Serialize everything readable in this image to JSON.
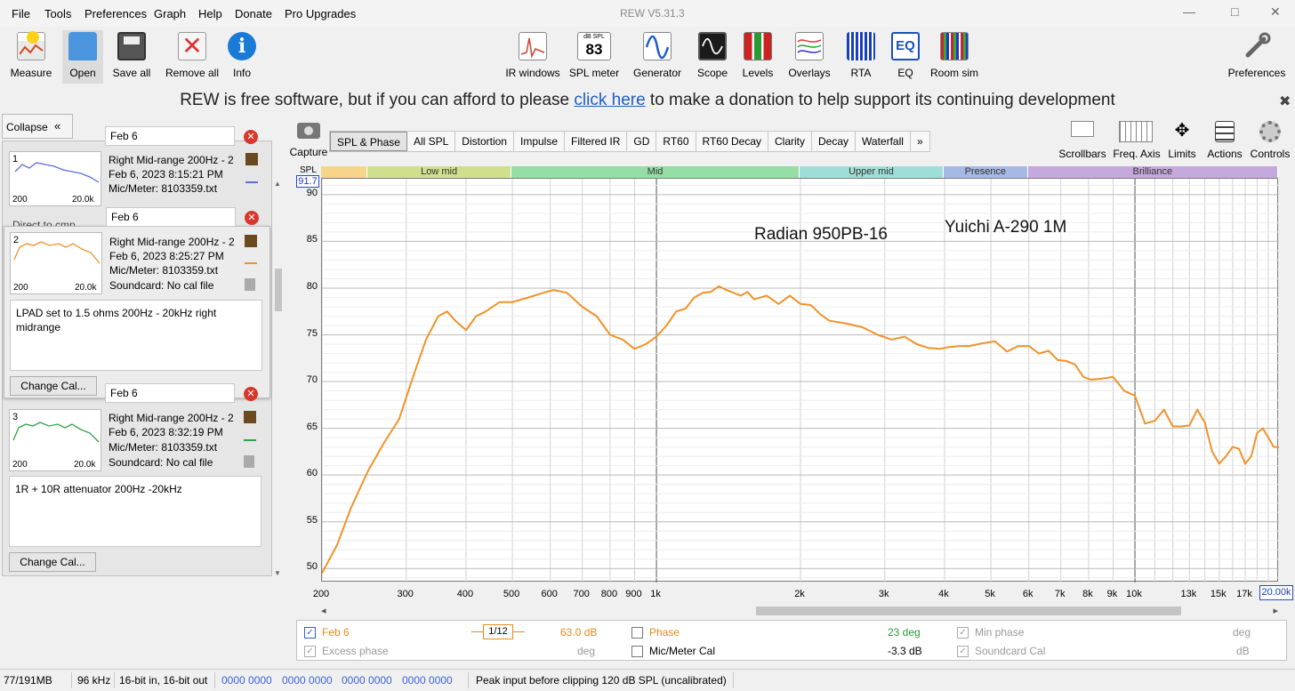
{
  "window": {
    "title": "REW V5.31.3",
    "minimize": "—",
    "maximize": "□",
    "close": "✕"
  },
  "menu": [
    "File",
    "Tools",
    "Preferences",
    "Graph",
    "Help",
    "Donate",
    "Pro Upgrades"
  ],
  "toolbar": {
    "left": [
      {
        "label": "Measure",
        "icon": "measure-icon"
      },
      {
        "label": "Open",
        "icon": "open-folder-icon"
      },
      {
        "label": "Save all",
        "icon": "save-all-icon"
      },
      {
        "label": "Remove all",
        "icon": "remove-all-icon"
      },
      {
        "label": "Info",
        "icon": "info-icon"
      }
    ],
    "center": [
      {
        "label": "IR windows",
        "icon": "ir-windows-icon"
      },
      {
        "label": "SPL meter",
        "icon": "spl-meter-icon",
        "top": "dB SPL",
        "value": "83"
      },
      {
        "label": "Generator",
        "icon": "generator-icon"
      },
      {
        "label": "Scope",
        "icon": "scope-icon"
      },
      {
        "label": "Levels",
        "icon": "levels-icon"
      },
      {
        "label": "Overlays",
        "icon": "overlays-icon"
      },
      {
        "label": "RTA",
        "icon": "rta-icon"
      },
      {
        "label": "EQ",
        "icon": "eq-icon"
      },
      {
        "label": "Room sim",
        "icon": "room-sim-icon"
      }
    ],
    "right": {
      "label": "Preferences",
      "icon": "wrench-icon"
    }
  },
  "donation": {
    "before": "REW is free software, but if you can afford to please ",
    "link": "click here",
    "after": " to make a donation to help support its continuing development",
    "close": "✖"
  },
  "sidebar": {
    "collapse_label": "Collapse",
    "collapse_icon": "«",
    "measurements": [
      {
        "num": "1",
        "name": "Feb 6",
        "title": "Right Mid-range 200Hz - 2",
        "date": "Feb 6, 2023 8:15:21 PM",
        "mic": "Mic/Meter: 8103359.txt",
        "sound": "",
        "x_start": "200",
        "x_end": "20.0k",
        "color": "#5a6ee0",
        "notes": "",
        "partial": "Direct to cmp",
        "show_change_cal": false
      },
      {
        "num": "2",
        "name": "Feb 6",
        "title": "Right Mid-range 200Hz - 2",
        "date": "Feb 6, 2023 8:25:27 PM",
        "mic": "Mic/Meter: 8103359.txt",
        "sound": "Soundcard: No cal file",
        "x_start": "200",
        "x_end": "20.0k",
        "color": "#f0922a",
        "notes": "LPAD set to 1.5 ohms 200Hz - 20kHz right midrange",
        "change_cal": "Change Cal..."
      },
      {
        "num": "3",
        "name": "Feb 6",
        "title": "Right Mid-range 200Hz - 2",
        "date": "Feb 6, 2023 8:32:19 PM",
        "mic": "Mic/Meter: 8103359.txt",
        "sound": "Soundcard: No cal file",
        "x_start": "200",
        "x_end": "20.0k",
        "color": "#2fa34a",
        "notes": "1R + 10R attenuator 200Hz -20kHz",
        "change_cal": "Change Cal..."
      }
    ]
  },
  "graph": {
    "capture_label": "Capture",
    "tabs": [
      "SPL & Phase",
      "All SPL",
      "Distortion",
      "Impulse",
      "Filtered IR",
      "GD",
      "RT60",
      "RT60 Decay",
      "Clarity",
      "Decay",
      "Waterfall",
      "»"
    ],
    "active_tab": "SPL & Phase",
    "right_controls": [
      {
        "label": "Scrollbars",
        "icon": "scrollbars-icon"
      },
      {
        "label": "Freq. Axis",
        "icon": "freq-axis-icon"
      },
      {
        "label": "Limits",
        "icon": "limits-icon"
      },
      {
        "label": "Actions",
        "icon": "actions-icon"
      },
      {
        "label": "Controls",
        "icon": "controls-icon"
      }
    ],
    "y_unit": "SPL",
    "cursor_value": "91.7",
    "bands": [
      {
        "name": "",
        "color": "#f6d58a",
        "from": 200,
        "to": 250
      },
      {
        "name": "Low mid",
        "color": "#cfe08d",
        "from": 250,
        "to": 500
      },
      {
        "name": "Mid",
        "color": "#95dfa6",
        "from": 500,
        "to": 2000
      },
      {
        "name": "Upper mid",
        "color": "#9fded8",
        "from": 2000,
        "to": 4000
      },
      {
        "name": "Presence",
        "color": "#a6b8e4",
        "from": 4000,
        "to": 6000
      },
      {
        "name": "Brilliance",
        "color": "#c5a9dc",
        "from": 6000,
        "to": 20000
      }
    ],
    "annotations": [
      "Radian 950PB-16",
      "Yuichi A-290 1M"
    ],
    "x_ticks": [
      "200",
      "300",
      "400",
      "500",
      "600",
      "700",
      "800",
      "900",
      "1k",
      "2k",
      "3k",
      "4k",
      "5k",
      "6k",
      "7k",
      "8k",
      "9k",
      "10k",
      "13k",
      "15k",
      "17k"
    ],
    "x_end_label": "20.00k",
    "scroll_left": "◂",
    "scroll_right": "▸"
  },
  "chart_data": {
    "type": "line",
    "xscale": "log",
    "xlim": [
      200,
      20000
    ],
    "ylim": [
      48.5,
      91.7
    ],
    "y_ticks": [
      50,
      55,
      60,
      65,
      70,
      75,
      80,
      85,
      90
    ],
    "series": [
      {
        "name": "Feb 6",
        "color": "#f0922a",
        "x": [
          200,
          215,
          230,
          250,
          270,
          290,
          310,
          330,
          350,
          365,
          380,
          400,
          420,
          440,
          470,
          500,
          540,
          580,
          610,
          650,
          700,
          750,
          800,
          850,
          900,
          950,
          1000,
          1050,
          1100,
          1150,
          1200,
          1250,
          1300,
          1350,
          1400,
          1450,
          1500,
          1550,
          1600,
          1700,
          1800,
          1900,
          2000,
          2100,
          2200,
          2300,
          2500,
          2700,
          2900,
          3100,
          3300,
          3500,
          3700,
          3900,
          4100,
          4300,
          4500,
          4800,
          5100,
          5400,
          5700,
          6000,
          6300,
          6600,
          6900,
          7200,
          7500,
          7800,
          8100,
          8500,
          9000,
          9500,
          10000,
          10500,
          11000,
          11500,
          12000,
          12500,
          13000,
          13500,
          14000,
          14500,
          15000,
          15500,
          16000,
          16500,
          17000,
          17500,
          18000,
          18500,
          19000,
          19500,
          20000
        ],
        "y": [
          49.5,
          52.5,
          56.5,
          60.5,
          63.5,
          66,
          70.5,
          74.5,
          77,
          77.5,
          76.5,
          75.5,
          77,
          77.5,
          78.5,
          78.5,
          79,
          79.5,
          79.8,
          79.5,
          78,
          77,
          75,
          74.5,
          73.5,
          74,
          74.8,
          76,
          77.5,
          77.8,
          79,
          79.5,
          79.6,
          80.2,
          79.8,
          79.5,
          79.2,
          79.6,
          78.8,
          79.2,
          78.3,
          79.2,
          78.3,
          78.2,
          77.2,
          76.5,
          76.2,
          75.8,
          75,
          74.5,
          74.8,
          74,
          73.6,
          73.5,
          73.7,
          73.8,
          73.8,
          74.1,
          74.3,
          73.2,
          73.8,
          73.8,
          73,
          73.3,
          72.3,
          72.2,
          71.8,
          70.5,
          70.2,
          70.3,
          70.5,
          69,
          68.5,
          65.5,
          65.8,
          67,
          65.2,
          65.2,
          65.3,
          67,
          65.6,
          62.5,
          61.2,
          62,
          63,
          62.8,
          61.2,
          62,
          64.5,
          65,
          64,
          63,
          63
        ]
      }
    ]
  },
  "legend": {
    "row1": [
      {
        "label": "Feb 6",
        "checked": true
      },
      {
        "smoothing": "1/12"
      },
      {
        "value": "63.0 dB"
      },
      {
        "label": "Phase",
        "checked": false
      },
      {
        "value": "23 deg"
      },
      {
        "label": "Min phase",
        "checked": true,
        "disabled": true
      },
      {
        "value": "deg"
      }
    ],
    "row2": [
      {
        "label": "Excess phase",
        "checked": true,
        "disabled": true
      },
      {
        "value": "deg"
      },
      {
        "label": "Mic/Meter Cal",
        "checked": false
      },
      {
        "value": "-3.3 dB"
      },
      {
        "label": "Soundcard Cal",
        "checked": true,
        "disabled": true
      },
      {
        "value": "dB"
      }
    ]
  },
  "status": {
    "memory": "77/191MB",
    "rate": "96 kHz",
    "bits": "16-bit in, 16-bit out",
    "levels": [
      "0000 0000",
      "0000 0000",
      "0000 0000",
      "0000 0000"
    ],
    "peak": "Peak input before clipping 120 dB SPL (uncalibrated)"
  }
}
